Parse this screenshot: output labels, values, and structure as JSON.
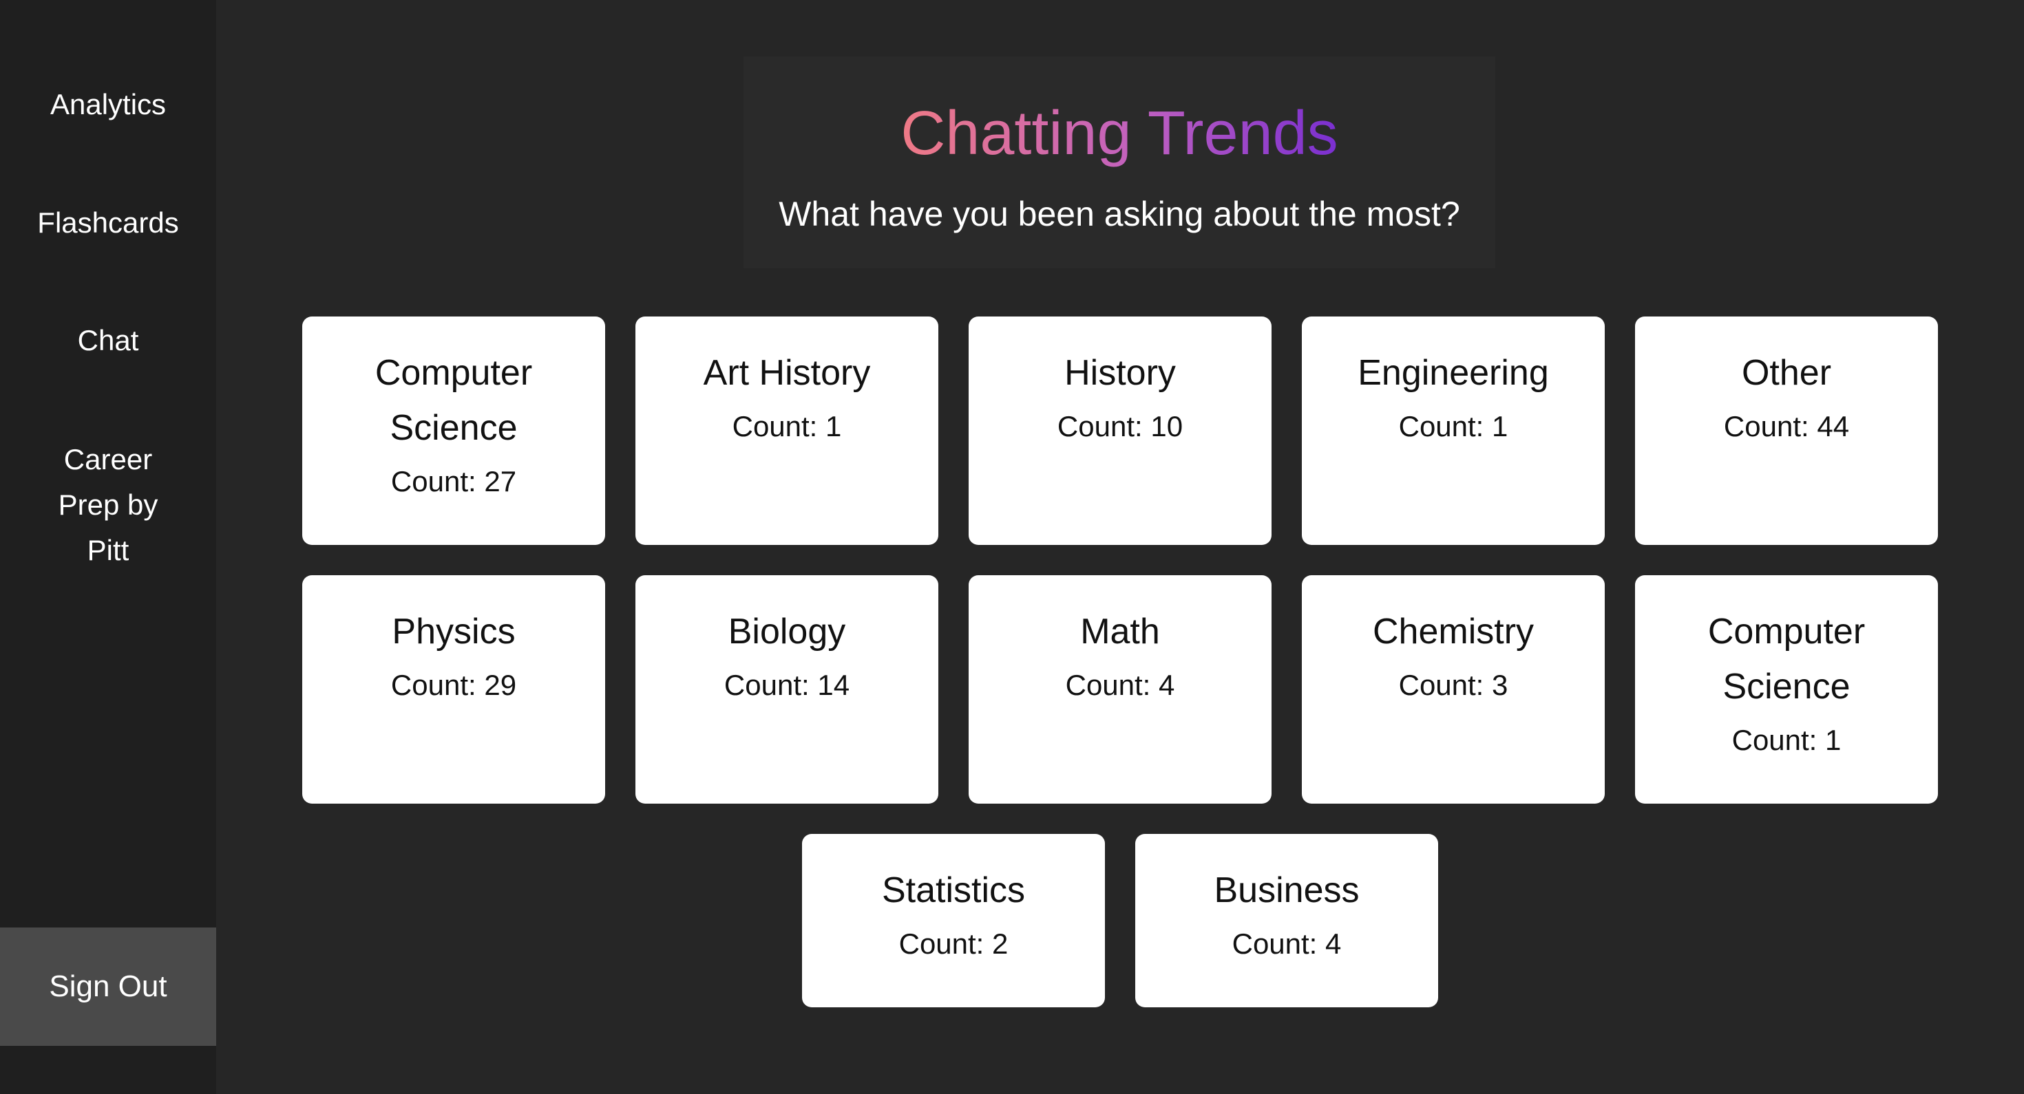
{
  "sidebar": {
    "items": [
      {
        "label": "Analytics"
      },
      {
        "label": "Flashcards"
      },
      {
        "label": "Chat"
      },
      {
        "label": "Career Prep by Pitt"
      }
    ],
    "sign_out_label": "Sign Out"
  },
  "header": {
    "title": "Chatting Trends",
    "subtitle": "What have you been asking about the most?",
    "title_gradient": [
      "#ef7a86",
      "#c060c0",
      "#7a2fd0"
    ]
  },
  "categories": [
    {
      "name": "Computer Science",
      "count": "Count: 27"
    },
    {
      "name": "Art History",
      "count": "Count: 1"
    },
    {
      "name": "History",
      "count": "Count: 10"
    },
    {
      "name": "Engineering",
      "count": "Count: 1"
    },
    {
      "name": "Other",
      "count": "Count: 44"
    },
    {
      "name": "Physics",
      "count": "Count: 29"
    },
    {
      "name": "Biology",
      "count": "Count: 14"
    },
    {
      "name": "Math",
      "count": "Count: 4"
    },
    {
      "name": "Chemistry",
      "count": "Count: 3"
    },
    {
      "name": "Computer Science",
      "count": "Count: 1"
    },
    {
      "name": "Statistics",
      "count": "Count: 2"
    },
    {
      "name": "Business",
      "count": "Count: 4"
    }
  ],
  "colors": {
    "background": "#262626",
    "sidebar": "#1f1f1f",
    "sign_out_bg": "#4a4a4a",
    "card": "#ffffff"
  }
}
